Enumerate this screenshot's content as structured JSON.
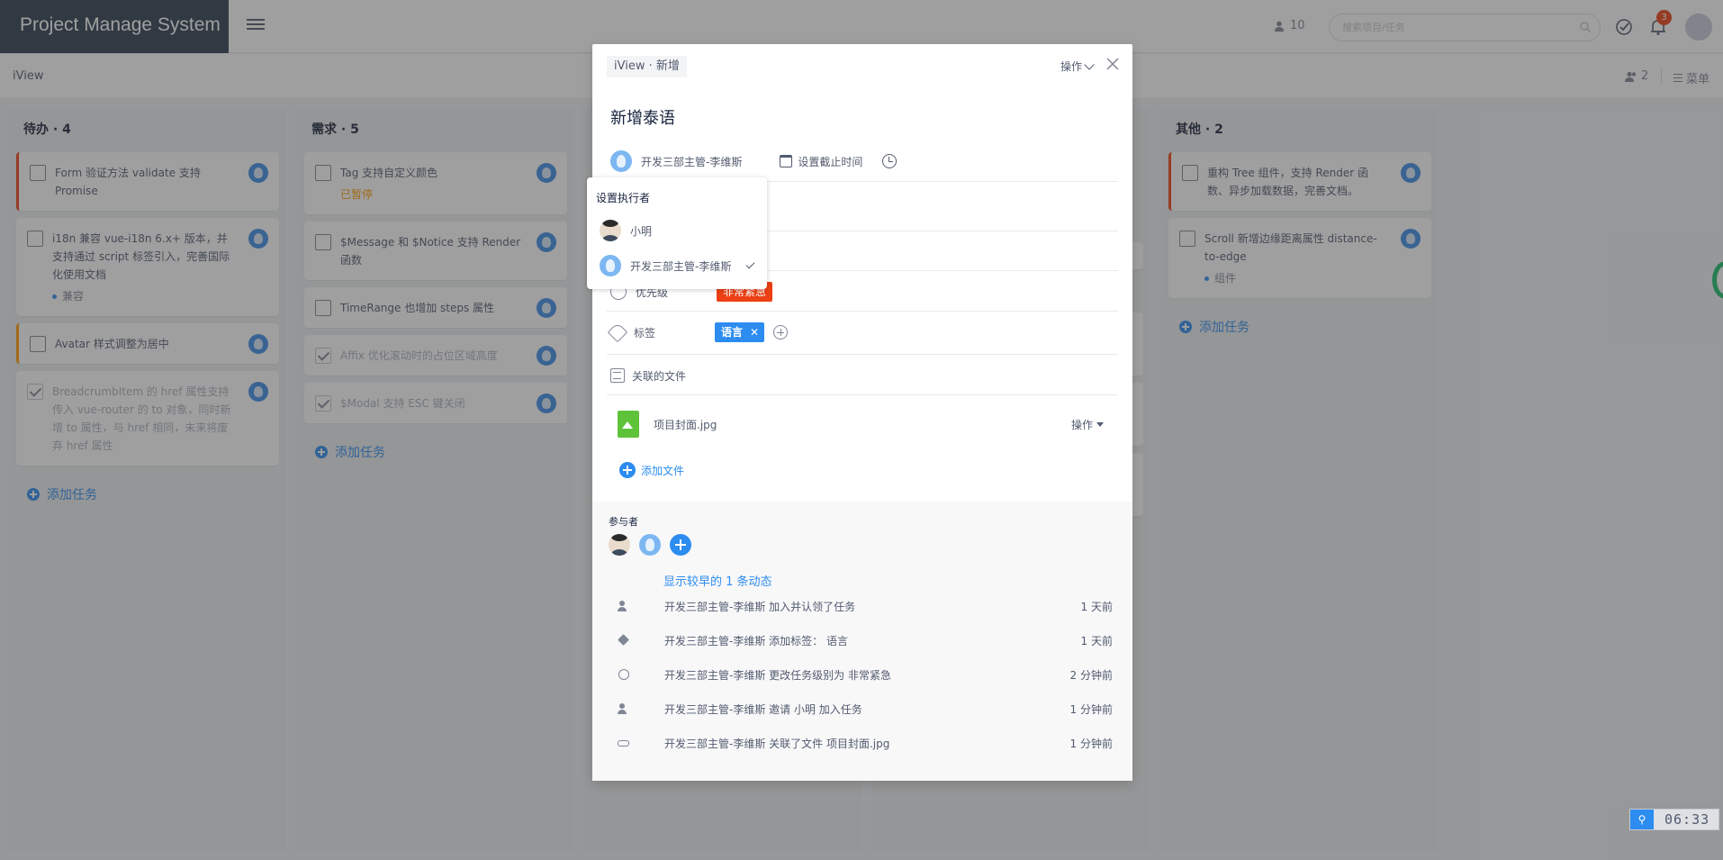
{
  "app": {
    "title": "Project Manage System",
    "online_count": "10",
    "search_placeholder": "搜索项目/任务",
    "notification_count": "3"
  },
  "subbar": {
    "project": "iView",
    "member_count": "2",
    "menu_label": "菜单"
  },
  "columns": [
    {
      "title": "待办 · 4",
      "cards": [
        {
          "text": "Form 验证方法 validate 支持 Promise",
          "bar": "red",
          "done": false
        },
        {
          "text": "i18n 兼容 vue-i18n 6.x+ 版本，并支持通过 script 标签引入，完善国际化使用文档",
          "tag": "兼容",
          "done": false
        },
        {
          "text": "Avatar 样式调整为居中",
          "bar": "orange",
          "done": false
        },
        {
          "text": "BreadcrumbItem 的 href 属性支持传入 vue-router 的 to 对象，同时新增 to 属性，与 href 相同，未来将废弃 href 属性",
          "done": true
        }
      ],
      "add_label": "添加任务"
    },
    {
      "title": "需求 · 5",
      "cards": [
        {
          "text": "Tag 支持自定义颜色",
          "status": "已暂停",
          "done": false
        },
        {
          "text": "$Message 和 $Notice 支持 Render 函数",
          "done": false
        },
        {
          "text": "TimeRange 也增加 steps 属性",
          "done": false
        },
        {
          "text": "Affix 优化滚动时的占位区域高度",
          "done": true
        },
        {
          "text": "$Modal 支持 ESC 键关闭",
          "done": true
        }
      ],
      "add_label": "添加任务"
    },
    {
      "title": "其他 · 2",
      "cards": [
        {
          "text": "重构 Tree 组件，支持 Render 函数、异步加载数据，完善文档。",
          "bar": "red",
          "done": false
        },
        {
          "text": "Scroll 新增边缘距离属性 distance-to-edge",
          "tag": "组件",
          "done": false
        }
      ],
      "add_label": "添加任务"
    }
  ],
  "modal": {
    "breadcrumb": "iView · 新增",
    "actions_label": "操作",
    "title": "新增泰语",
    "assignee": "开发三部主管-李维斯",
    "due_label": "设置截止时间",
    "priority_label": "优先级",
    "priority_value": "非常紧急",
    "tags_label": "标签",
    "tag_value": "语言",
    "files_label": "关联的文件",
    "file_name": "项目封面.jpg",
    "file_actions": "操作",
    "add_file_label": "添加文件",
    "participants_label": "参与者",
    "show_earlier": "显示较早的 1 条动态",
    "activities": [
      {
        "icon": "user-add",
        "text": "开发三部主管-李维斯 加入并认领了任务",
        "time": "1 天前"
      },
      {
        "icon": "tag",
        "text": "开发三部主管-李维斯 添加标签： 语言",
        "time": "1 天前"
      },
      {
        "icon": "circle",
        "text": "开发三部主管-李维斯 更改任务级别为 非常紧急",
        "time": "2 分钟前"
      },
      {
        "icon": "user-add",
        "text": "开发三部主管-李维斯 邀请 小明 加入任务",
        "time": "1 分钟前"
      },
      {
        "icon": "link",
        "text": "开发三部主管-李维斯 关联了文件 项目封面.jpg",
        "time": "1 分钟前"
      }
    ]
  },
  "assignee_dropdown": {
    "title": "设置执行者",
    "options": [
      {
        "name": "小明",
        "selected": false
      },
      {
        "name": "开发三部主管-李维斯",
        "selected": true
      }
    ]
  },
  "clock": "06:33",
  "colors": {
    "logo_bg": "#2d3e50",
    "primary": "#2d8cf0",
    "danger": "#ed4014",
    "warning": "#ff9900",
    "success": "#19be6b",
    "file_icon": "#5fc33a"
  }
}
